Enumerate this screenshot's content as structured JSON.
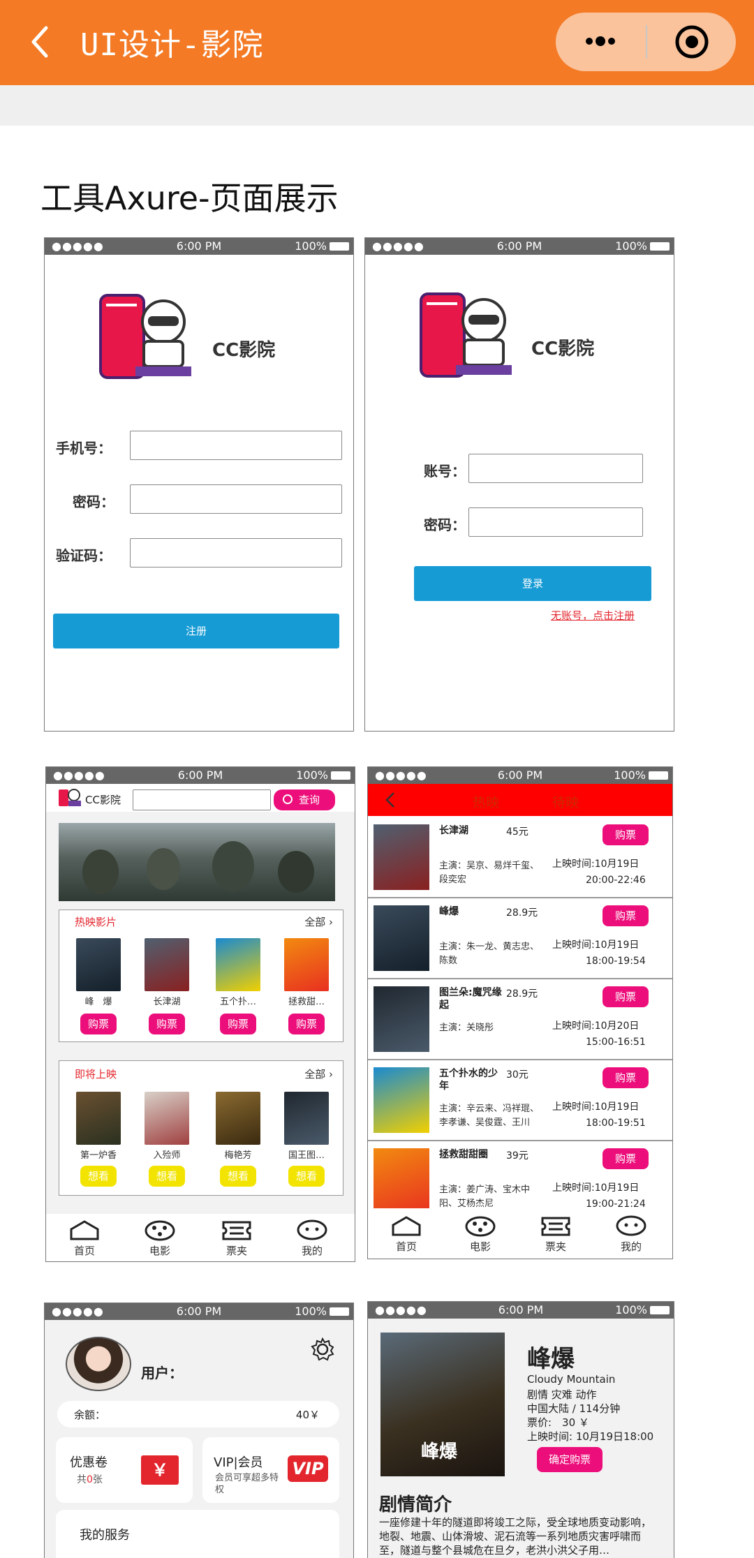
{
  "header": {
    "title": "UI设计-影院",
    "back_icon": "chevron-left-icon",
    "more_icon": "more-dots-icon",
    "close_icon": "target-close-icon"
  },
  "section_title": "工具Axure-页面展示",
  "statusbar": {
    "dots": "●●●●● ",
    "time": "6:00 PM",
    "battery": "100%"
  },
  "register": {
    "brand": "CC影院",
    "phone_label": "手机号：",
    "password_label": "密码：",
    "code_label": "验证码：",
    "button": "注册"
  },
  "login": {
    "brand": "CC影院",
    "account_label": "账号：",
    "password_label": "密码：",
    "button": "登录",
    "register_link": "无账号，点击注册"
  },
  "home": {
    "brand": "CC影院",
    "search_button": "查询",
    "hot": {
      "title": "热映影片",
      "more": "全部 ›",
      "movies": [
        "峰　爆",
        "长津湖",
        "五个扑…",
        "拯救甜…"
      ],
      "button": "购票"
    },
    "upcoming": {
      "title": "即将上映",
      "more": "全部 ›",
      "movies": [
        "第一炉香",
        "入殓师",
        "梅艳芳",
        "国王图…"
      ],
      "button": "想看"
    }
  },
  "tabs": [
    "首页",
    "电影",
    "票夹",
    "我的"
  ],
  "list": {
    "tab_hot": "热映",
    "tab_upcoming": "待映",
    "button": "购票",
    "rows": [
      {
        "name": "长津湖",
        "price": "45元",
        "actors": "主演：吴京、易烊千玺、段奕宏",
        "date": "上映时间:10月19日",
        "time": "20:00-22:46"
      },
      {
        "name": "峰爆",
        "price": "28.9元",
        "actors": "主演：朱一龙、黄志忠、陈数",
        "date": "上映时间:10月19日",
        "time": "18:00-19:54"
      },
      {
        "name": "图兰朵:魔咒缘起",
        "price": "28.9元",
        "actors": "主演：关晓彤",
        "date": "上映时间:10月20日",
        "time": "15:00-16:51"
      },
      {
        "name": "五个扑水的少年",
        "price": "30元",
        "actors": "主演：辛云来、冯祥琨、李孝谦、吴俊霆、王川",
        "date": "上映时间:10月19日",
        "time": "18:00-19:51"
      },
      {
        "name": "拯救甜甜圈",
        "price": "39元",
        "actors": "主演：姜广涛、宝木中阳、艾杨杰尼",
        "date": "上映时间:10月19日",
        "time": "19:00-21:24"
      }
    ]
  },
  "profile": {
    "user_label": "用户：",
    "balance_label": "余额：",
    "balance_value": "40￥",
    "coupon_title": "优惠卷",
    "coupon_sub_pre": "共",
    "coupon_count": "0",
    "coupon_sub_post": "张",
    "coupon_badge": "￥",
    "vip_title": "VIP|会员",
    "vip_sub": "会员可享超多特权",
    "vip_badge": "VIP",
    "services": "我的服务"
  },
  "detail": {
    "title": "峰爆",
    "en_title": "Cloudy Mountain",
    "genre": "剧情 灾难 动作",
    "region": "中国大陆 / 114分钟",
    "price": "票价:　30 ￥",
    "release": "上映时间: 10月19日18:00",
    "buy_button": "确定购票",
    "poster_text": "峰爆",
    "synopsis_title": "剧情简介",
    "synopsis": "一座修建十年的隧道即将竣工之际，受全球地质变动影响，地裂、地震、山体滑坡、泥石流等一系列地质灾害呼啸而至，隧道与整个县城危在旦夕，老洪小洪父子用…"
  },
  "colors": {
    "accent": "#f47a25",
    "pink": "#ec0f7b",
    "blue": "#169bd5",
    "red": "#ff0000",
    "yellow": "#f2e400"
  }
}
